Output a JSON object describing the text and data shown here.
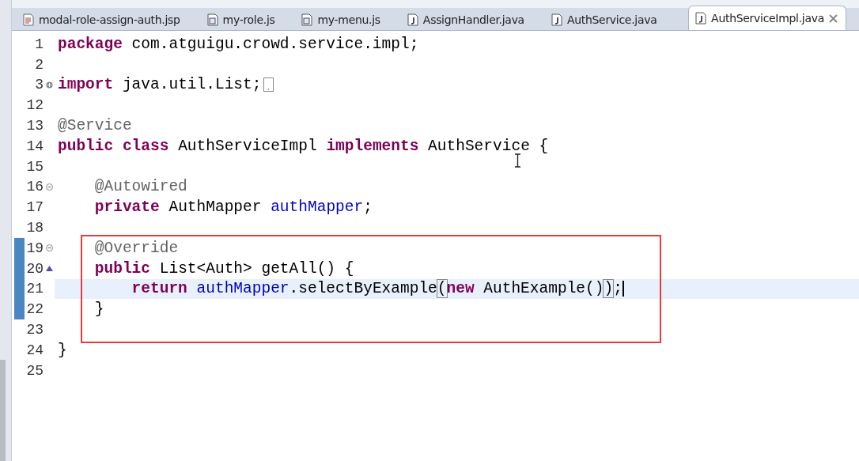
{
  "tabs": [
    {
      "label": "modal-role-assign-auth.jsp",
      "kind": "jsp",
      "selected": false
    },
    {
      "label": "my-role.js",
      "kind": "js",
      "selected": false
    },
    {
      "label": "my-menu.js",
      "kind": "js",
      "selected": false
    },
    {
      "label": "AssignHandler.java",
      "kind": "java",
      "selected": false
    },
    {
      "label": "AuthService.java",
      "kind": "java",
      "selected": false
    },
    {
      "label": "AuthServiceImpl.java",
      "kind": "java",
      "selected": true
    }
  ],
  "lines": [
    {
      "number": "1",
      "tokens": [
        {
          "kind": "keyword",
          "text": "package"
        },
        {
          "kind": "plain",
          "text": " com.atguigu.crowd.service.impl;"
        }
      ]
    },
    {
      "number": "2"
    },
    {
      "number": "3",
      "expand_marker": true,
      "folded": true,
      "tokens": [
        {
          "kind": "keyword",
          "text": "import"
        },
        {
          "kind": "plain",
          "text": " java.util.List;"
        }
      ]
    },
    {
      "number": "12"
    },
    {
      "number": "13",
      "tokens": [
        {
          "kind": "annotation",
          "text": "@Service"
        }
      ]
    },
    {
      "number": "14",
      "tokens": [
        {
          "kind": "keyword",
          "text": "public class"
        },
        {
          "kind": "plain",
          "text": " AuthServiceImpl "
        },
        {
          "kind": "keyword",
          "text": "implements"
        },
        {
          "kind": "plain",
          "text": " AuthService {"
        }
      ]
    },
    {
      "number": "15"
    },
    {
      "number": "16",
      "collapse_marker": true,
      "tokens": [
        {
          "kind": "annotation",
          "text": "    @Autowired"
        }
      ]
    },
    {
      "number": "17",
      "tokens": [
        {
          "kind": "keyword",
          "text": "    private"
        },
        {
          "kind": "plain",
          "text": " AuthMapper "
        },
        {
          "kind": "field",
          "text": "authMapper"
        },
        {
          "kind": "plain",
          "text": ";"
        }
      ]
    },
    {
      "number": "18"
    },
    {
      "number": "19",
      "collapse_marker": true,
      "changed": true,
      "boxed": true,
      "tokens": [
        {
          "kind": "annotation",
          "text": "    @Override"
        }
      ]
    },
    {
      "number": "20",
      "override_marker": true,
      "changed": true,
      "boxed": true,
      "tokens": [
        {
          "kind": "keyword",
          "text": "    public"
        },
        {
          "kind": "plain",
          "text": " List<Auth> getAll() {"
        }
      ]
    },
    {
      "number": "21",
      "changed": true,
      "boxed": true,
      "current": true,
      "tokens": [
        {
          "kind": "keyword",
          "text": "        return "
        },
        {
          "kind": "field",
          "text": "authMapper"
        },
        {
          "kind": "plain",
          "text": ".selectByExample"
        },
        {
          "kind": "match",
          "text": "("
        },
        {
          "kind": "keyword",
          "text": "new"
        },
        {
          "kind": "plain",
          "text": " AuthExample()"
        },
        {
          "kind": "match",
          "text": ")"
        },
        {
          "kind": "plain",
          "text": ";"
        }
      ]
    },
    {
      "number": "22",
      "changed": true,
      "boxed": true,
      "tokens": [
        {
          "kind": "plain",
          "text": "    }"
        }
      ]
    },
    {
      "number": "23",
      "boxed": true
    },
    {
      "number": "24",
      "tokens": [
        {
          "kind": "plain",
          "text": "}"
        }
      ]
    },
    {
      "number": "25"
    }
  ]
}
